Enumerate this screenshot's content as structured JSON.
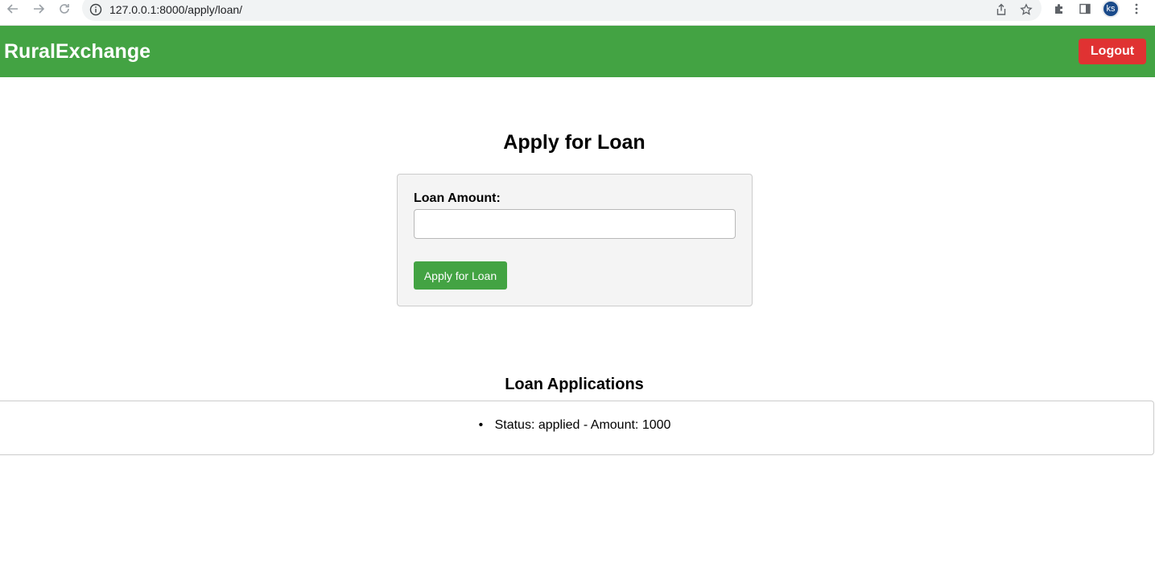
{
  "browser": {
    "url": "127.0.0.1:8000/apply/loan/",
    "profile_initials": "ks"
  },
  "header": {
    "brand": "RuralExchange",
    "logout_label": "Logout"
  },
  "main": {
    "title": "Apply for Loan",
    "form": {
      "amount_label": "Loan Amount:",
      "amount_value": "",
      "submit_label": "Apply for Loan"
    },
    "applications": {
      "title": "Loan Applications",
      "items": [
        {
          "text": "Status: applied - Amount: 1000"
        }
      ]
    }
  },
  "colors": {
    "header_bg": "#43a343",
    "logout_bg": "#e03232",
    "primary_button": "#43a343"
  },
  "icons": [
    "back-arrow-icon",
    "forward-arrow-icon",
    "reload-icon",
    "info-icon",
    "share-icon",
    "bookmark-star-icon",
    "extensions-puzzle-icon",
    "side-panel-icon",
    "more-vertical-icon"
  ]
}
